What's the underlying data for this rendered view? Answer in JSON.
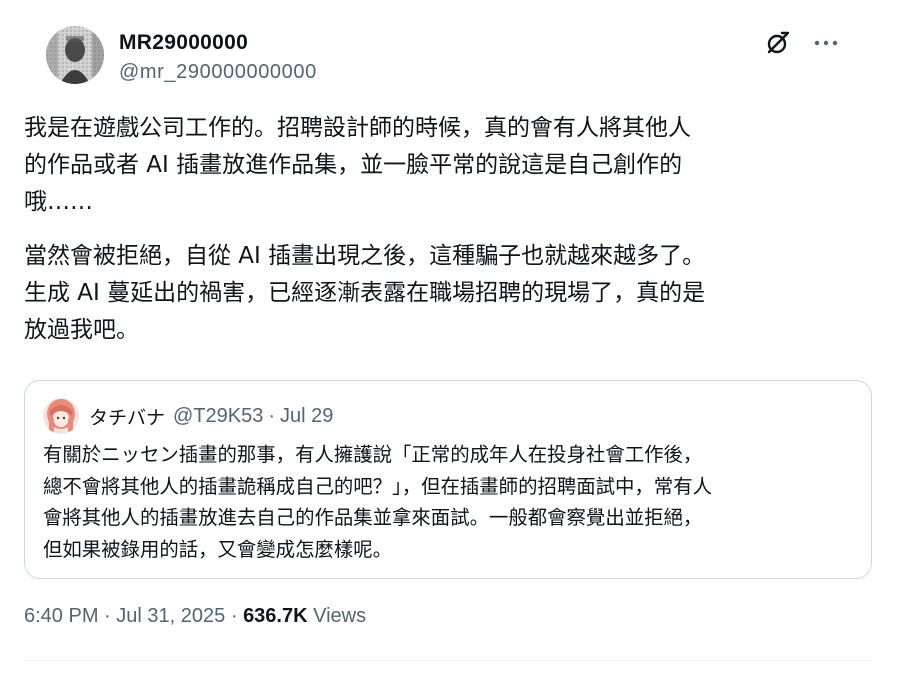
{
  "author": {
    "display_name": "MR29000000",
    "handle": "@mr_290000000000"
  },
  "header_actions": [
    {
      "icon": "grok-icon"
    },
    {
      "icon": "more-options-icon"
    }
  ],
  "tweet": {
    "paragraphs": [
      "我是在遊戲公司工作的。招聘設計師的時候，真的會有人將其他人\n的作品或者 AI 插畫放進作品集，並一臉平常的說這是自己創作的\n哦……",
      "當然會被拒絕，自從 AI 插畫出現之後，這種騙子也就越來越多了。\n生成 AI 蔓延出的禍害，已經逐漸表露在職場招聘的現場了，真的是\n放過我吧。"
    ]
  },
  "quoted_tweet": {
    "display_name": "タチバナ",
    "handle": "@T29K53",
    "separator": "·",
    "date": "Jul 29",
    "text": "有關於ニッセン插畫的那事，有人擁護說「正常的成年人在投身社會工作後，\n總不會將其他人的插畫詭稱成自己的吧？」，但在插畫師的招聘面試中，常有人\n會將其他人的插畫放進去自己的作品集並拿來面試。一般都會察覺出並拒絕，\n但如果被錄用的話，又會變成怎麼樣呢。"
  },
  "meta": {
    "time": "6:40 PM",
    "separator": "·",
    "date": "Jul 31, 2025",
    "views_count": "636.7K",
    "views_label": "Views"
  }
}
